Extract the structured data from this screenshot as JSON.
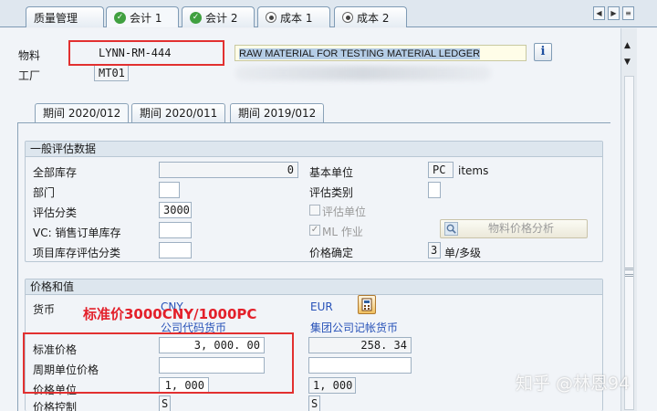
{
  "tabs": [
    {
      "label": "质量管理",
      "icon": "none"
    },
    {
      "label": "会计 1",
      "icon": "check-icon"
    },
    {
      "label": "会计 2",
      "icon": "check-icon"
    },
    {
      "label": "成本 1",
      "icon": "radio-icon"
    },
    {
      "label": "成本 2",
      "icon": "radio-icon"
    }
  ],
  "header": {
    "material_label": "物料",
    "material_value": "LYNN-RM-444",
    "material_desc": "RAW MATERIAL FOR TESTING MATERIAL LEDGER",
    "plant_label": "工厂",
    "plant_value": "MT01"
  },
  "period_tabs": [
    "期间 2020/012",
    "期间 2020/011",
    "期间 2019/012"
  ],
  "general": {
    "title": "一般评估数据",
    "total_stock_label": "全部库存",
    "total_stock_value": "0",
    "department_label": "部门",
    "department_value": "",
    "valuation_class_label": "评估分类",
    "valuation_class_value": "3000",
    "vc_sales_label": "VC: 销售订单库存",
    "vc_sales_value": "",
    "project_stock_label": "项目库存评估分类",
    "project_stock_value": "",
    "base_unit_label": "基本单位",
    "base_unit_value": "PC",
    "base_unit_text": "items",
    "valuation_category_label": "评估类别",
    "valuation_category_value": "",
    "valuation_unit_label": "评估单位",
    "ml_active_label": "ML 作业",
    "ml_active_checked": "✓",
    "price_determination_label": "价格确定",
    "price_determination_value": "3",
    "price_determination_text": "单/多级",
    "analysis_button": "物料价格分析"
  },
  "prices": {
    "title": "价格和值",
    "currency_label": "货币",
    "company_currency": "CNY",
    "company_currency_text": "公司代码货币",
    "group_currency": "EUR",
    "group_currency_text": "集团公司记帐货币",
    "standard_price_label": "标准价格",
    "standard_price_value": "3, 000. 00",
    "standard_price_group": "258. 34",
    "periodic_price_label": "周期单位价格",
    "periodic_price_value": "",
    "periodic_price_group": "",
    "price_unit_label": "价格单位",
    "price_unit_value": "1, 000",
    "price_unit_group": "1, 000",
    "price_control_label": "价格控制",
    "price_control_value": "S",
    "price_control_group": "S"
  },
  "annotation": "标准价3000CNY/1000PC",
  "watermark": "知乎 @林恩94",
  "colors": {
    "annotation": "#e3202a",
    "highlight_box": "#e23030",
    "currency_blue": "#2852b8"
  }
}
